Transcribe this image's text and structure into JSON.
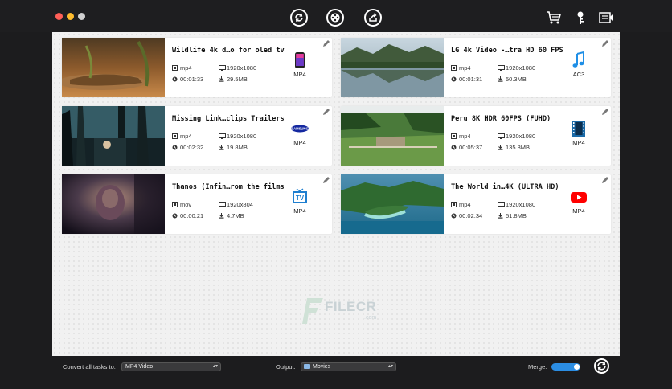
{
  "toolbar": {
    "icons": [
      "convert-icon",
      "film-reel-icon",
      "share-icon",
      "cart-icon",
      "key-icon",
      "register-icon"
    ]
  },
  "cards": [
    {
      "title": "Wildlife 4k d…o for oled tv",
      "format": "mp4",
      "resolution": "1920x1080",
      "duration": "00:01:33",
      "size": "29.5MB",
      "output": "MP4",
      "output_icon": "iphone-icon"
    },
    {
      "title": "LG 4k Video -…tra HD 60 FPS",
      "format": "mp4",
      "resolution": "1920x1080",
      "duration": "00:01:31",
      "size": "50.3MB",
      "output": "AC3",
      "output_icon": "music-note-icon"
    },
    {
      "title": "Missing Link…clips Trailers",
      "format": "mp4",
      "resolution": "1920x1080",
      "duration": "00:02:32",
      "size": "19.8MB",
      "output": "MP4",
      "output_icon": "samsung-icon"
    },
    {
      "title": "Peru 8K HDR 60FPS (FUHD)",
      "format": "mp4",
      "resolution": "1920x1080",
      "duration": "00:05:37",
      "size": "135.8MB",
      "output": "MP4",
      "output_icon": "film-strip-icon"
    },
    {
      "title": "Thanos (Infin…rom the films",
      "format": "mov",
      "resolution": "1920x804",
      "duration": "00:00:21",
      "size": "4.7MB",
      "output": "MP4",
      "output_icon": "tv-icon"
    },
    {
      "title": "The World in…4K (ULTRA HD)",
      "format": "mp4",
      "resolution": "1920x1080",
      "duration": "00:02:34",
      "size": "51.8MB",
      "output": "MP4",
      "output_icon": "youtube-icon"
    }
  ],
  "watermark": {
    "brand": "FILECR",
    "domain": ".com"
  },
  "bottom": {
    "convert_all_label": "Convert all tasks to:",
    "convert_all_value": "MP4 Video",
    "output_label": "Output:",
    "output_value": "Movies",
    "merge_label": "Merge:",
    "merge_on": true
  },
  "colors": {
    "accent": "#2b8de3",
    "background": "#1c1c1e",
    "panel": "#f1f1f1"
  }
}
